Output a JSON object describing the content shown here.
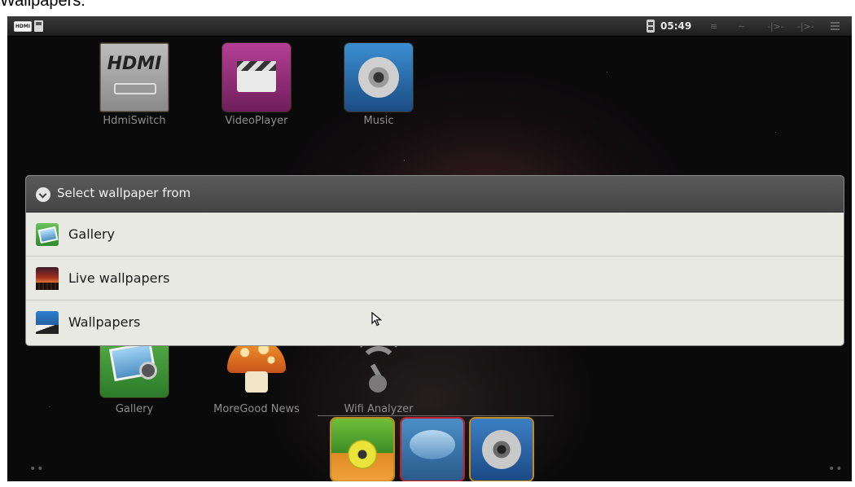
{
  "caption": "Wallpapers:",
  "status_bar": {
    "hdmi_badge": "HDMI",
    "time": "05:49",
    "soft_icons": [
      "≡",
      "∼",
      "-|>-",
      "-|>-"
    ],
    "soft_icon_names": [
      "back-icon",
      "home-icon",
      "volume-down-icon",
      "volume-up-icon"
    ]
  },
  "apps_top": [
    {
      "label": "HdmiSwitch",
      "icon": "hdmi-switch-icon"
    },
    {
      "label": "VideoPlayer",
      "icon": "video-player-icon"
    },
    {
      "label": "Music",
      "icon": "music-icon"
    }
  ],
  "apps_bottom": [
    {
      "label": "Gallery",
      "icon": "gallery-icon"
    },
    {
      "label": "MoreGood News",
      "icon": "mushroom-icon"
    },
    {
      "label": "Wifi Analyzer",
      "icon": "wifi-analyzer-icon"
    }
  ],
  "hdmi_tile_text": "HDMI",
  "dialog": {
    "title": "Select wallpaper from",
    "items": [
      {
        "label": "Gallery",
        "icon": "gallery-icon"
      },
      {
        "label": "Live wallpapers",
        "icon": "live-wallpapers-icon"
      },
      {
        "label": "Wallpapers",
        "icon": "wallpapers-icon"
      }
    ]
  },
  "dock_icons": [
    "media-player-icon",
    "browser-icon",
    "music-disc-icon"
  ],
  "page_indicator_left": "••",
  "page_indicator_right": "••",
  "colors": {
    "dialog_title_bg": "#4f4f4f",
    "dialog_body_bg": "#e9e9e4",
    "background": "#0b0a0b"
  }
}
